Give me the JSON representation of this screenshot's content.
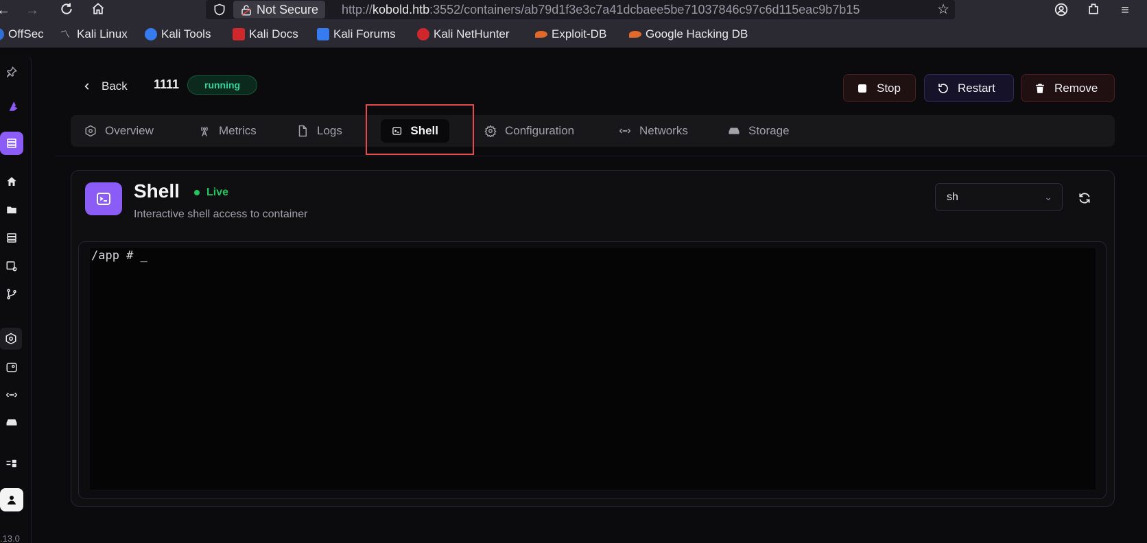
{
  "browser": {
    "url_security": "Not Secure",
    "url_prefix": "http://",
    "url_host": "kobold.htb",
    "url_rest": ":3552/containers/ab79d1f3e3c7a41dcbaee5be71037846c97c6d115eac9b7b15",
    "bookmarks": [
      {
        "label": "OffSec",
        "color": "#2f6fd6"
      },
      {
        "label": "Kali Linux",
        "color": "#1c1c1c"
      },
      {
        "label": "Kali Tools",
        "color": "#367bf0"
      },
      {
        "label": "Kali Docs",
        "color": "#d0272d"
      },
      {
        "label": "Kali Forums",
        "color": "#367bf0"
      },
      {
        "label": "Kali NetHunter",
        "color": "#d0272d"
      },
      {
        "label": "Exploit-DB",
        "color": "#e0692b"
      },
      {
        "label": "Google Hacking DB",
        "color": "#e0692b"
      }
    ]
  },
  "header": {
    "back_label": "Back",
    "container_name": "1111",
    "status": "running",
    "stop_label": "Stop",
    "restart_label": "Restart",
    "remove_label": "Remove"
  },
  "tabs": [
    {
      "label": "Overview",
      "icon": "hexagon-icon"
    },
    {
      "label": "Metrics",
      "icon": "antenna-icon"
    },
    {
      "label": "Logs",
      "icon": "file-icon"
    },
    {
      "label": "Shell",
      "icon": "terminal-icon",
      "active": true
    },
    {
      "label": "Configuration",
      "icon": "gear-icon"
    },
    {
      "label": "Networks",
      "icon": "arrows-icon"
    },
    {
      "label": "Storage",
      "icon": "drive-icon"
    }
  ],
  "shell": {
    "title": "Shell",
    "live_label": "Live",
    "subtitle": "Interactive shell access to container",
    "shell_selected": "sh",
    "terminal_text": "/app # _"
  },
  "sidebar": {
    "version": ".13.0"
  },
  "colors": {
    "accent": "#8b5cf6",
    "status_running": "#34d399",
    "live": "#22c55e",
    "highlight": "#e5484d"
  }
}
